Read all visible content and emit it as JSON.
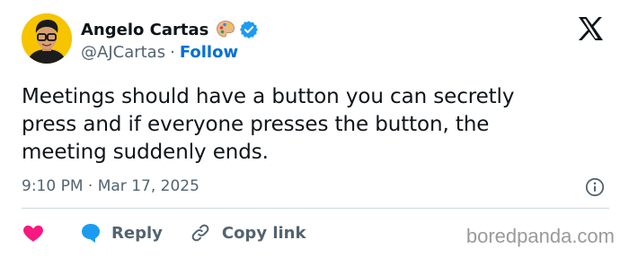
{
  "tweet": {
    "author_name": "Angelo Cartas",
    "author_handle": "@AJCartas",
    "separator": "·",
    "follow_label": "Follow",
    "text": "Meetings should have a button you can secretly\npress and if everyone presses the button, the\nmeeting suddenly ends.",
    "timestamp": "9:10 PM · Mar 17, 2025"
  },
  "actions": {
    "reply_label": "Reply",
    "copy_link_label": "Copy link"
  },
  "watermark": "boredpanda.com",
  "icons": {
    "author_emoji": "artist-palette-icon",
    "verified": "verified-badge-icon",
    "platform": "x-logo-icon",
    "info": "info-icon",
    "like": "heart-icon",
    "reply": "reply-bubble-icon",
    "copy_link": "link-icon"
  },
  "colors": {
    "text": "#0f1419",
    "secondary": "#536471",
    "follow": "#006fd6",
    "verified": "#1d9bf0",
    "heart": "#f91880",
    "reply": "#1d9bf0",
    "divider": "#cfd9de",
    "avatar_bg": "#f7c400",
    "watermark": "#9a9a9a"
  }
}
